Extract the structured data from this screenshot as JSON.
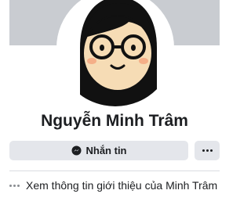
{
  "profile": {
    "name": "Nguyễn Minh Trâm"
  },
  "actions": {
    "message_label": "Nhắn tin",
    "message_icon": "messenger-icon",
    "more_icon": "more-dots-icon"
  },
  "about": {
    "label": "Xem thông tin giới thiệu của Minh Trâm",
    "icon": "more-dots-icon"
  },
  "colors": {
    "cover": "#c9ccd1",
    "button_bg": "#e4e6eb",
    "text": "#1c1e21",
    "muted": "#8a8d91"
  }
}
